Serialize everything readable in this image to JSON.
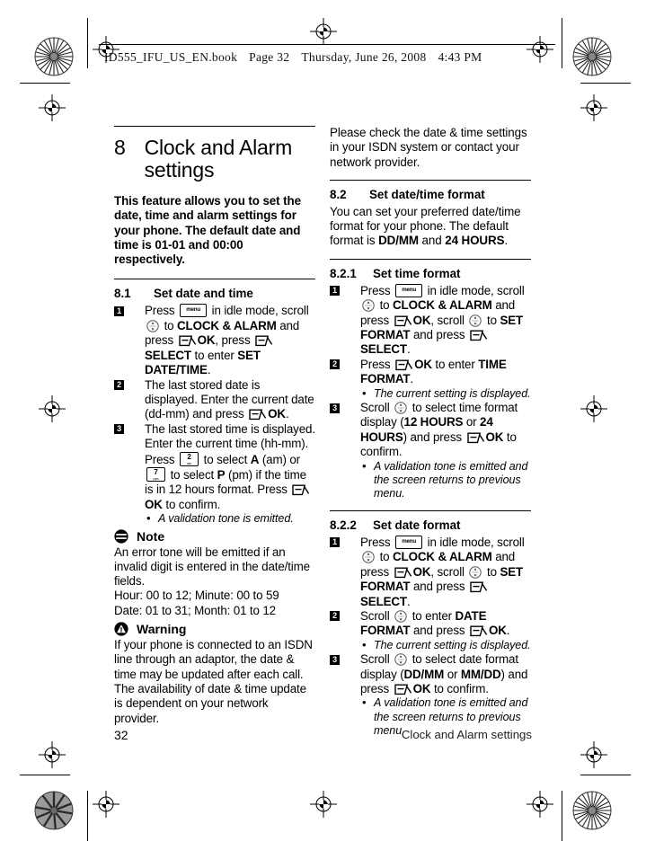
{
  "scan_header": {
    "file": "ID555_IFU_US_EN.book",
    "page": "Page 32",
    "day": "Thursday, June 26, 2008",
    "time": "4:43 PM"
  },
  "chapter": {
    "number": "8",
    "title": "Clock and Alarm settings",
    "intro_1": "This feature allows you to set the date, time and alarm settings for your phone. The default date and time is ",
    "intro_b1": "01-01",
    "intro_2": " and ",
    "intro_b2": "00:00",
    "intro_3": " respectively."
  },
  "s81": {
    "number": "8.1",
    "title": "Set date and time",
    "step1": {
      "t1": "Press ",
      "t2": " in idle mode, scroll ",
      "t3": " to ",
      "b1": "CLOCK & ALARM",
      "t4": " and press ",
      "b2": "OK",
      "t5": ", press ",
      "b3": "SELECT",
      "t6": " to enter ",
      "b4": "SET DATE/TIME",
      "t7": "."
    },
    "step2": "The last stored date is displayed. Enter the current date (dd-mm) and press ",
    "step2_b": "OK",
    "step2_end": ".",
    "step3": {
      "t1": "The last stored time is displayed. Enter the current time (hh-mm). Press ",
      "t2": " to select ",
      "b1": "A",
      "t3": " (am) or ",
      "t4": " to select ",
      "b2": "P",
      "t5": " (pm) if the time is in 12 hours format.  Press ",
      "b3": "OK",
      "t6": " to confirm.",
      "bullet": "A validation tone is emitted."
    }
  },
  "note": {
    "icon": "note-icon",
    "title": "Note",
    "line1": "An error tone will be emitted if an invalid digit is entered in the date/time fields.",
    "line2": "Hour: 00 to 12; Minute: 00 to 59",
    "line3": "Date: 01 to 31; Month: 01 to 12"
  },
  "warning": {
    "icon": "warning-icon",
    "title": "Warning",
    "text": "If your phone is connected to an ISDN line through an adaptor, the date & time may be updated after each call. The availability of date & time update is dependent on your network provider."
  },
  "right_intro": "Please check the date & time settings in your ISDN system or contact your network provider.",
  "s82": {
    "number": "8.2",
    "title": "Set date/time format",
    "body_1": "You can set your preferred date/time format for your phone. The default format is ",
    "body_b1": "DD/MM",
    "body_2": " and ",
    "body_b2": "24 HOURS",
    "body_3": "."
  },
  "s821": {
    "number": "8.2.1",
    "title": "Set time format",
    "step1": {
      "t1": "Press ",
      "t2": " in idle mode, scroll ",
      "t3": " to ",
      "b1": "CLOCK & ALARM",
      "t4": " and press ",
      "b2": "OK",
      "t5": ", scroll ",
      "t6": " to ",
      "b3": "SET FORMAT",
      "t7": " and press ",
      "b4": "SELECT",
      "t8": "."
    },
    "step2": {
      "t1": "Press ",
      "b1": "OK",
      "t2": " to enter ",
      "b2": "TIME FORMAT",
      "t3": ".",
      "bullet": "The current setting is displayed."
    },
    "step3": {
      "t1": "Scroll ",
      "t2": " to select time format display (",
      "b1": "12 HOURS",
      "t3": " or ",
      "b2": "24 HOURS",
      "t4": ") and press ",
      "b3": "OK",
      "t5": " to confirm.",
      "bullet": "A validation tone is emitted and the screen returns to previous menu."
    }
  },
  "s822": {
    "number": "8.2.2",
    "title": "Set date format",
    "step1": {
      "t1": "Press ",
      "t2": " in idle mode, scroll ",
      "t3": " to ",
      "b1": "CLOCK & ALARM",
      "t4": " and press ",
      "b2": "OK",
      "t5": ", scroll ",
      "t6": " to ",
      "b3": "SET FORMAT",
      "t7": " and press ",
      "b4": "SELECT",
      "t8": "."
    },
    "step2": {
      "t1": "Scroll ",
      "t2": " to enter ",
      "b1": "DATE FORMAT",
      "t3": " and press ",
      "b2": "OK",
      "t4": ".",
      "bullet": "The current setting is displayed."
    },
    "step3": {
      "t1": "Scroll ",
      "t2": " to select date format display (",
      "b1": "DD/MM",
      "t3": " or ",
      "b2": "MM/DD",
      "t4": ") and press ",
      "b3": "OK",
      "t5": " to confirm.",
      "bullet": "A validation tone is emitted and the screen returns to previous menu."
    }
  },
  "keys": {
    "menu_label": "menu",
    "num2": "2",
    "num2_sub": "abc",
    "num7": "7",
    "num7_sub": "pqrs"
  },
  "footer": {
    "page_number": "32",
    "chapter_title": "Clock and Alarm settings"
  }
}
